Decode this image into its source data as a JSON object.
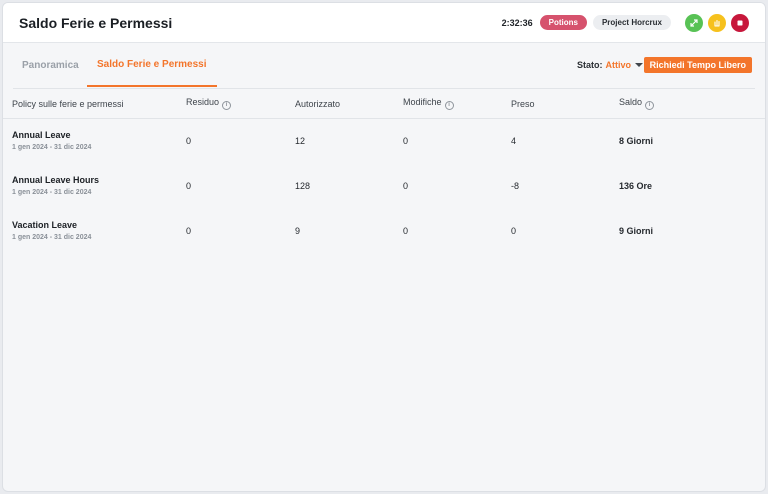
{
  "header": {
    "title": "Saldo Ferie e Permessi",
    "timer": "2:32:36",
    "tag": "Potions",
    "project": "Project Horcrux",
    "actions": [
      {
        "icon": "swap-icon",
        "color": "#58c255"
      },
      {
        "icon": "pause-hand-icon",
        "color": "#f6c11d"
      },
      {
        "icon": "stop-icon",
        "color": "#c7173b"
      }
    ]
  },
  "tabs": [
    {
      "label": "Panoramica",
      "active": false
    },
    {
      "label": "Saldo Ferie e Permessi",
      "active": true
    }
  ],
  "status": {
    "label": "Stato",
    "value": "Attivo"
  },
  "request_button": "Richiedi Tempo Libero",
  "table": {
    "columns": [
      "Policy sulle ferie e permessi",
      "Residuo",
      "Autorizzato",
      "Modifiche",
      "Preso",
      "Saldo"
    ],
    "rows": [
      {
        "name": "Annual Leave",
        "range": "1 gen 2024 - 31 dic 2024",
        "residuo": "0",
        "autorizzato": "12",
        "modifiche": "0",
        "preso": "4",
        "saldo": "8 Giorni"
      },
      {
        "name": "Annual Leave Hours",
        "range": "1 gen 2024 - 31 dic 2024",
        "residuo": "0",
        "autorizzato": "128",
        "modifiche": "0",
        "preso": "-8",
        "saldo": "136 Ore"
      },
      {
        "name": "Vacation Leave",
        "range": "1 gen 2024 - 31 dic 2024",
        "residuo": "0",
        "autorizzato": "9",
        "modifiche": "0",
        "preso": "0",
        "saldo": "9 Giorni"
      }
    ]
  },
  "colors": {
    "accent": "#f3752b",
    "tag": "#d6526d"
  }
}
